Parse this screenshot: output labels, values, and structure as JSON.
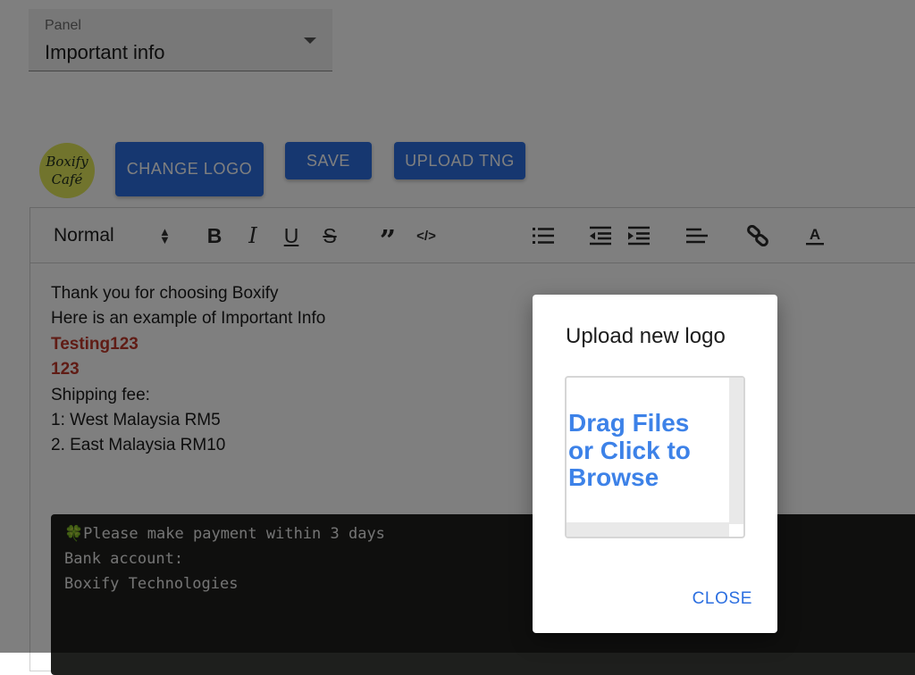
{
  "panel": {
    "label": "Panel",
    "value": "Important info"
  },
  "logo": {
    "line1": "Boxify",
    "line2": "Café"
  },
  "buttons": {
    "change_logo": "CHANGE LOGO",
    "save": "SAVE",
    "upload_tng": "UPLOAD TNG"
  },
  "toolbar": {
    "heading": "Normal",
    "bold": "B",
    "italic": "I",
    "underline": "U",
    "strike": "S",
    "quote": "”",
    "code": "</>",
    "icons": [
      "bullet-list-icon",
      "outdent-icon",
      "indent-icon",
      "align-left-icon",
      "link-icon",
      "text-color-icon"
    ]
  },
  "content": {
    "lines": [
      "Thank you for choosing Boxify",
      "Here is an example of Important Info",
      "Testing123",
      "123",
      "Shipping fee:",
      "1: West Malaysia RM5",
      "2. East Malaysia RM10"
    ],
    "code_lines": [
      "🍀Please make payment within 3 days",
      "Bank account:",
      "Boxify Technologies"
    ]
  },
  "colors": {
    "primary": "#2c6fe0",
    "link": "#3d82e8",
    "accent_red": "#c0392b",
    "logo_bg": "#e3e85a"
  },
  "dialog": {
    "title": "Upload new logo",
    "dropzone_text": "Drag Files or Click to Browse",
    "close": "CLOSE"
  }
}
